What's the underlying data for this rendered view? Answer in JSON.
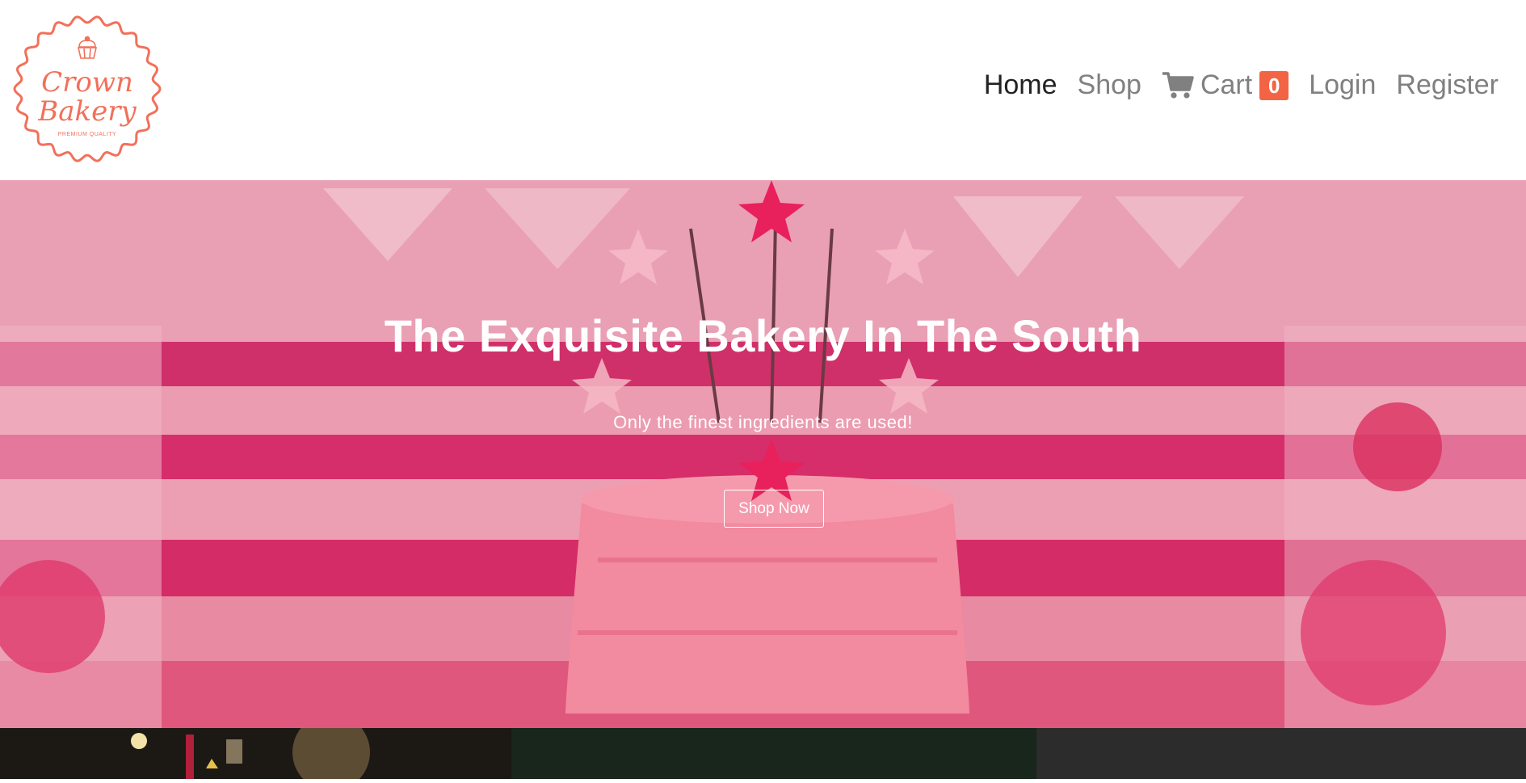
{
  "logo": {
    "line1": "Crown",
    "line2": "Bakery",
    "tagline": "PREMIUM QUALITY",
    "icon": "cupcake-icon"
  },
  "nav": {
    "home": "Home",
    "shop": "Shop",
    "cart": "Cart",
    "cart_count": "0",
    "cart_icon": "cart-icon",
    "login": "Login",
    "register": "Register"
  },
  "hero": {
    "title": "The Exquisite Bakery In The South",
    "subtitle": "Only the finest ingredients are used!",
    "button": "Shop Now"
  },
  "colors": {
    "accent": "#f26444",
    "logo": "#f2705a",
    "hero_overlay": "#e2557d",
    "nav_active": "#222222",
    "nav_inactive": "#808080"
  }
}
